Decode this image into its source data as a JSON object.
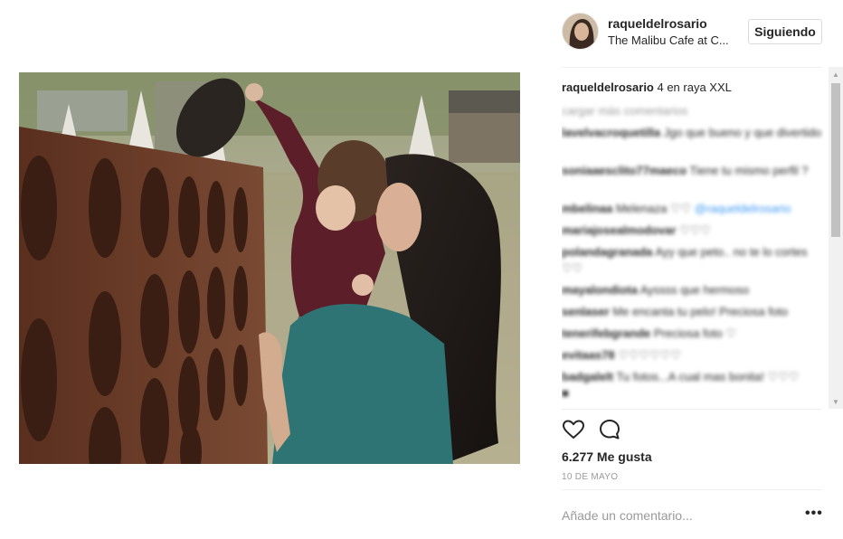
{
  "post": {
    "username": "raqueldelrosario",
    "location": "The Malibu Cafe at C...",
    "follow_label": "Siguiendo",
    "caption_user": "raqueldelrosario",
    "caption_text": " 4 en raya XXL",
    "load_more": "cargar más comentarios",
    "comments": [
      {
        "user": "lavelvacroquetilla",
        "text": " Jgo que bueno y que divertido"
      },
      {
        "user": "soniaaesclito77maeco",
        "text": " Tiene tu mismo perfil ?"
      },
      {
        "user": "mbelinaa",
        "text": " Melenaza ♡♡ ",
        "mention": "@raqueldelrosario"
      },
      {
        "user": "mariajosealmodovar",
        "text": " ♡♡♡"
      },
      {
        "user": "polandagranada",
        "text": " Ayy que peto.. no te lo cortes ♡♡"
      },
      {
        "user": "mayalondiota",
        "text": " Ayssss que hermoso"
      },
      {
        "user": "senlaser",
        "text": " Me encanta tu pelo! Preciosa foto"
      },
      {
        "user": "tenerifebgrande",
        "text": " Preciosa foto ♡"
      },
      {
        "user": "evitaas78",
        "text": " ♡♡♡♡♡♡"
      },
      {
        "user": "badgalelt",
        "text": " Tu fotos...A cual mas bonita! ♡♡♡"
      },
      {
        "user": "",
        "text": "■"
      }
    ],
    "likes": "6.277 Me gusta",
    "date": "10 DE MAYO",
    "comment_placeholder": "Añade un comentario...",
    "more_label": "•••"
  },
  "icons": {
    "like": "heart-icon",
    "comment": "comment-bubble-icon",
    "scroll_up": "scroll-up-arrow-icon",
    "scroll_down": "scroll-down-arrow-icon"
  },
  "colors": {
    "text": "#262626",
    "muted": "#999999",
    "link": "#3897f0",
    "border": "#dbdbdb"
  }
}
